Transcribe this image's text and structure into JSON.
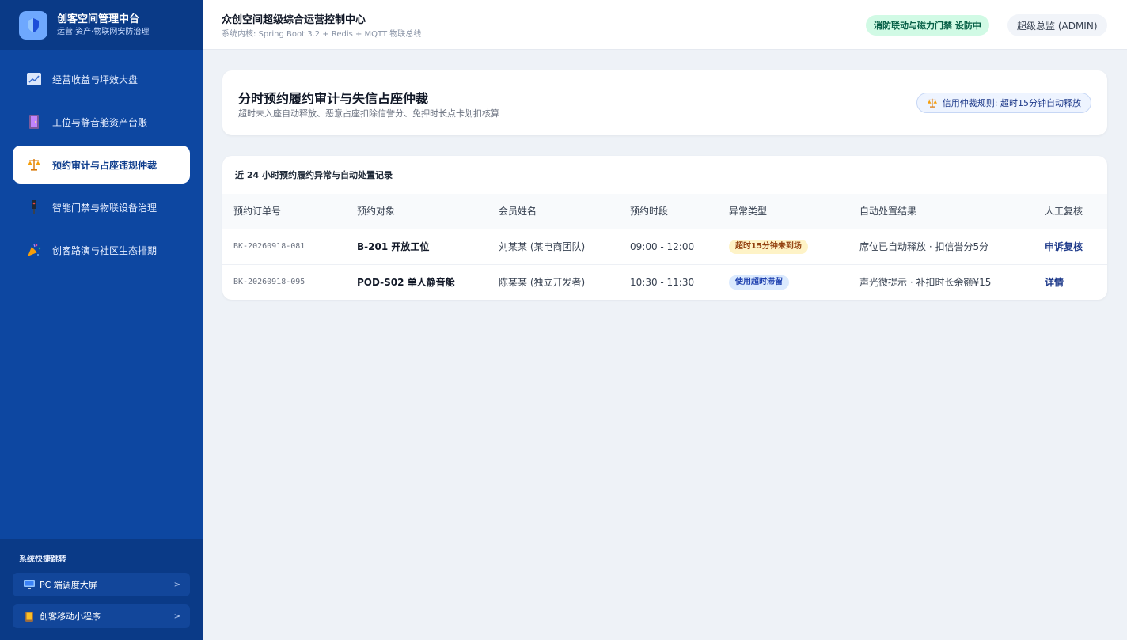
{
  "sidebar": {
    "title": "创客空间管理中台",
    "subtitle": "运营·资产·物联网安防治理",
    "items": [
      {
        "label": "经营收益与坪效大盘",
        "icon": "chart-icon"
      },
      {
        "label": "工位与静音舱资产台账",
        "icon": "door-icon"
      },
      {
        "label": "预约审计与占座违规仲裁",
        "icon": "scales-icon"
      },
      {
        "label": "智能门禁与物联设备治理",
        "icon": "device-icon"
      },
      {
        "label": "创客路演与社区生态排期",
        "icon": "party-icon"
      }
    ],
    "quick_title": "系统快捷跳转",
    "quick_links": [
      {
        "label": "PC 端调度大屏",
        "arrow": ">",
        "icon": "monitor-icon"
      },
      {
        "label": "创客移动小程序",
        "arrow": ">",
        "icon": "mobile-icon"
      }
    ]
  },
  "header": {
    "title": "众创空间超级综合运营控制中心",
    "subtitle": "系统内核: Spring Boot 3.2 + Redis + MQTT 物联总线",
    "status_badge": "消防联动与磁力门禁 设防中",
    "user": "超级总监 (ADMIN)"
  },
  "page": {
    "title": "分时预约履约审计与失信占座仲裁",
    "subtitle": "超时未入座自动释放、恶意占座扣除信誉分、免押时长点卡划扣核算",
    "rule_badge": "信用仲裁规则: 超时15分钟自动释放"
  },
  "table": {
    "title": "近 24 小时预约履约异常与自动处置记录",
    "columns": [
      "预约订单号",
      "预约对象",
      "会员姓名",
      "预约时段",
      "异常类型",
      "自动处置结果",
      "人工复核"
    ],
    "rows": [
      {
        "order_id": "BK-20260918-081",
        "target": "B-201 开放工位",
        "member": "刘某某 (某电商团队)",
        "time": "09:00 - 12:00",
        "type": "超时15分钟未到场",
        "type_color": "yellow",
        "result": "席位已自动释放 · 扣信誉分5分",
        "action": "申诉复核"
      },
      {
        "order_id": "BK-20260918-095",
        "target": "POD-S02 单人静音舱",
        "member": "陈某某 (独立开发者)",
        "time": "10:30 - 11:30",
        "type": "使用超时滞留",
        "type_color": "blue",
        "result": "声光微提示 · 补扣时长余额¥15",
        "action": "详情"
      }
    ]
  },
  "colors": {
    "sidebar_bg": "#0d47a1",
    "accent": "#1e3a8a",
    "success_bg": "#d1fae5"
  }
}
